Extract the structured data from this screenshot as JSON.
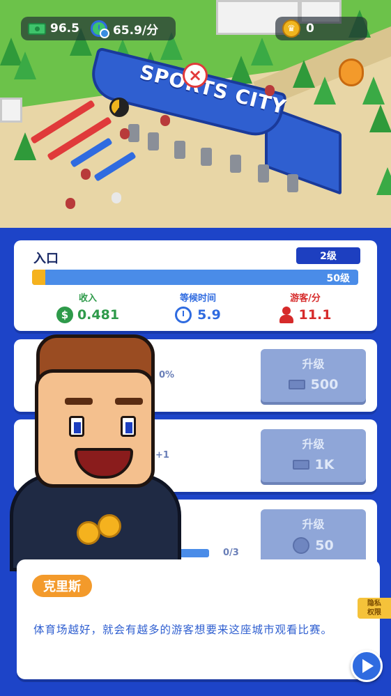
{
  "hud": {
    "cash": "96.5",
    "income_rate": "65.9/分",
    "trophies": "0"
  },
  "scene": {
    "gate_sign": "SPORTS CITY"
  },
  "gate_panel": {
    "title": "入口",
    "level": "2级",
    "max_level": "50级",
    "progress_fraction": 0.04,
    "stats": {
      "income_label": "收入",
      "income_value": "0.481",
      "wait_label": "等候时间",
      "wait_value": "5.9",
      "visitors_label": "游客/分",
      "visitors_value": "11.1"
    }
  },
  "upgrades": [
    {
      "button_label": "升级",
      "cost": "500",
      "fragment": "0%"
    },
    {
      "button_label": "升级",
      "cost": "1K",
      "fragment": "+1"
    },
    {
      "button_label": "升级",
      "cost": "50",
      "fragment": "0/3"
    }
  ],
  "dialog": {
    "speaker": "克里斯",
    "text": "体育场越好，就会有越多的游客想要来这座城市观看比赛。",
    "privacy_tab": "隐私\n权限"
  },
  "colors": {
    "primary_blue": "#1d44c8",
    "accent_orange": "#f39a2b",
    "income_green": "#2e9a4a",
    "visitor_red": "#d62a2a"
  }
}
